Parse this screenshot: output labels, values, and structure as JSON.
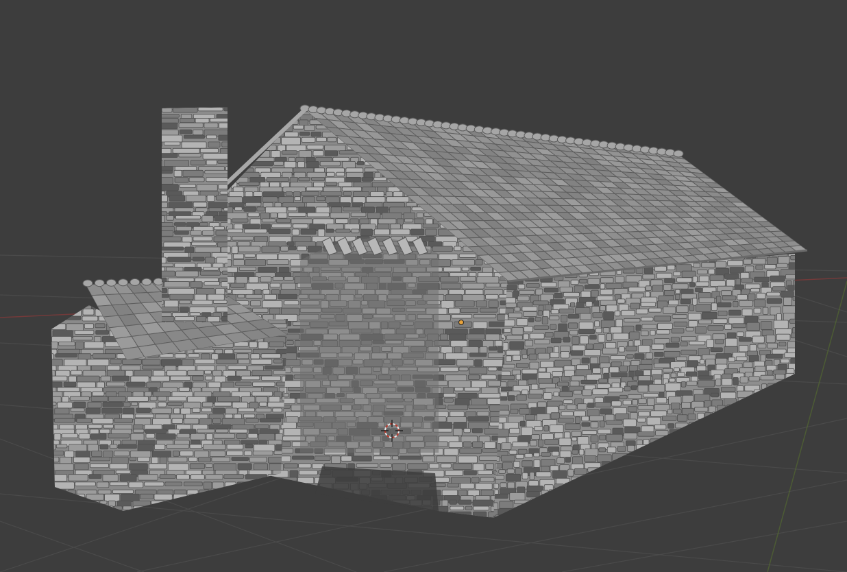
{
  "viewport": {
    "kind": "3d-viewport",
    "shading": "solid",
    "background_color": "#3d3d3d",
    "grid_color": "#4a4a4a",
    "axis_x_color": "#8a3a3a",
    "axis_y_color": "#5b7a2c",
    "model_color": "#8e8e8e",
    "stone_light": "#b4b4b4",
    "stone_dark": "#5a5a5a",
    "roof_color": "#8f8f8f",
    "cursor_color": "#e8e8e8",
    "cursor_accent": "#c0392b",
    "origin_color": "#e8a33c"
  },
  "scene": {
    "object": "stone-barn-with-annex-and-chimney",
    "icons": [
      "3d-cursor-icon",
      "object-origin-icon"
    ]
  }
}
